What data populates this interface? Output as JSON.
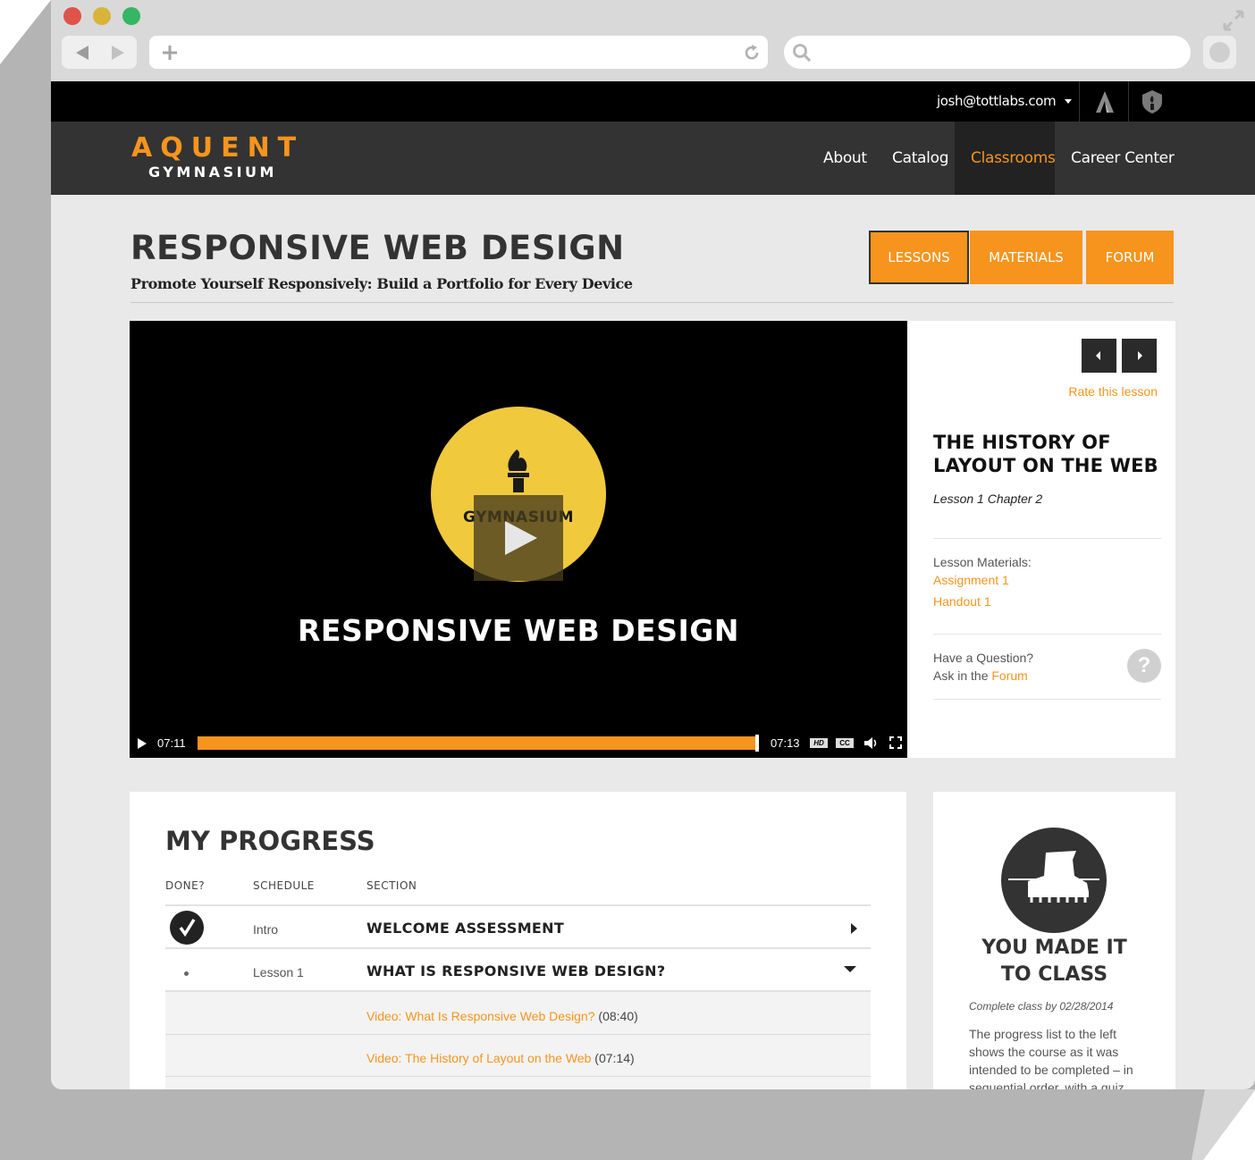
{
  "topbar": {
    "user_email": "josh@tottlabs.com"
  },
  "logo": {
    "line1": "AQUENT",
    "line2": "GYMNASIUM"
  },
  "nav": {
    "items": [
      "About",
      "Catalog",
      "Classrooms",
      "Career Center"
    ],
    "active": "Classrooms"
  },
  "course": {
    "title": "RESPONSIVE WEB DESIGN",
    "subtitle": "Promote Yourself Responsively: Build a Portfolio for Every Device"
  },
  "tabs": {
    "lessons": "LESSONS",
    "materials": "MATERIALS",
    "forum": "FORUM"
  },
  "video": {
    "badge_text": "GYMNASIUM",
    "title": "RESPONSIVE WEB DESIGN",
    "current_time": "07:11",
    "total_time": "07:13",
    "progress": 0.995,
    "hd_label": "HD",
    "cc_label": "CC"
  },
  "lesson_panel": {
    "rate_link": "Rate this lesson",
    "title_line1": "THE HISTORY OF",
    "title_line2": "LAYOUT ON THE WEB",
    "chapter": "Lesson 1 Chapter 2",
    "materials_label": "Lesson Materials:",
    "materials": [
      "Assignment 1",
      "Handout 1"
    ],
    "question_label": "Have a Question?",
    "ask_prefix": "Ask in the ",
    "ask_link": "Forum",
    "help_icon_glyph": "?"
  },
  "progress": {
    "title": "MY PROGRESS",
    "headers": {
      "done": "DONE?",
      "schedule": "SCHEDULE",
      "section": "SECTION"
    },
    "rows": [
      {
        "schedule": "Intro",
        "section": "WELCOME ASSESSMENT",
        "done": true
      },
      {
        "schedule": "Lesson 1",
        "section": "WHAT IS RESPONSIVE WEB DESIGN?",
        "done": false
      }
    ],
    "subitems": [
      {
        "link": "Video: What Is Responsive Web Design?",
        "duration": "(08:40)"
      },
      {
        "link": "Video: The History of Layout on the Web",
        "duration": "(07:14)"
      }
    ]
  },
  "badge_card": {
    "title_line1": "YOU MADE IT",
    "title_line2": "TO CLASS",
    "due": "Complete class by 02/28/2014",
    "body_lines": [
      "The progress list to the left",
      "shows the course as it was",
      "intended to be completed – in",
      "sequential order, with a quiz"
    ]
  },
  "colors": {
    "accent": "#f7941d",
    "dark": "#333333",
    "black": "#000000",
    "panel": "#ffffff",
    "page_bg": "#e9e9e9"
  }
}
